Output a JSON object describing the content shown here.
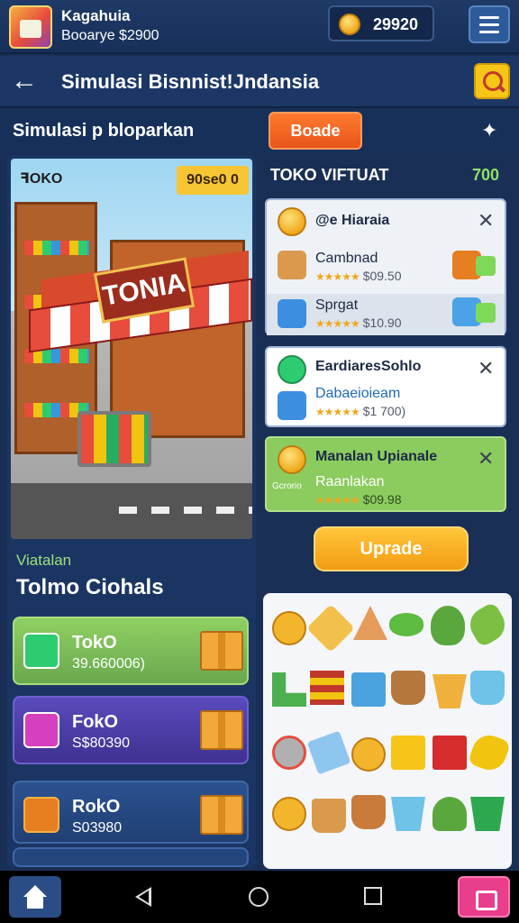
{
  "topbar": {
    "user_name": "Kagahuia",
    "user_sub": "Booarye $2900",
    "coins": "29920"
  },
  "header": {
    "title": "Simulasi Bisnnist!Jndansia"
  },
  "subheader": {
    "title": "Simulasi p bloparkan",
    "button_label": "Boade"
  },
  "scene": {
    "label": "ꟻOKO",
    "badge": "90se0 0",
    "sign": "TONIA"
  },
  "left": {
    "subtitle": "Viatalan",
    "heading": "Tolmo Ciohals",
    "cards": [
      {
        "title": "TokO",
        "value": "39.660006)",
        "color": "#7cb342"
      },
      {
        "title": "FokO",
        "value": "S$80390",
        "color": "#4a3fa3"
      },
      {
        "title": "RokO",
        "value": "S03980",
        "color": "#2a4d86"
      }
    ]
  },
  "right": {
    "title": "TOKO VIFTUAT",
    "count": "700",
    "group1": [
      {
        "title": "@e Hiaraia"
      },
      {
        "title": "Cambnad",
        "price": "$09.50"
      },
      {
        "title": "Sprgat",
        "price": "$10.90"
      }
    ],
    "group2": [
      {
        "title": "EardiaresSohlo"
      },
      {
        "title": "Dabaeioieam",
        "price": "$1 700)"
      }
    ],
    "group3": [
      {
        "title": "Manalan Upianale"
      },
      {
        "title": "Raanlakan",
        "price": "$09.98",
        "tag": "Gcrorio"
      }
    ],
    "upgrade_label": "Uprade"
  },
  "colors": {
    "accent_orange": "#e8551a",
    "accent_yellow": "#f5c518",
    "green_card": "#8ccc5e"
  }
}
